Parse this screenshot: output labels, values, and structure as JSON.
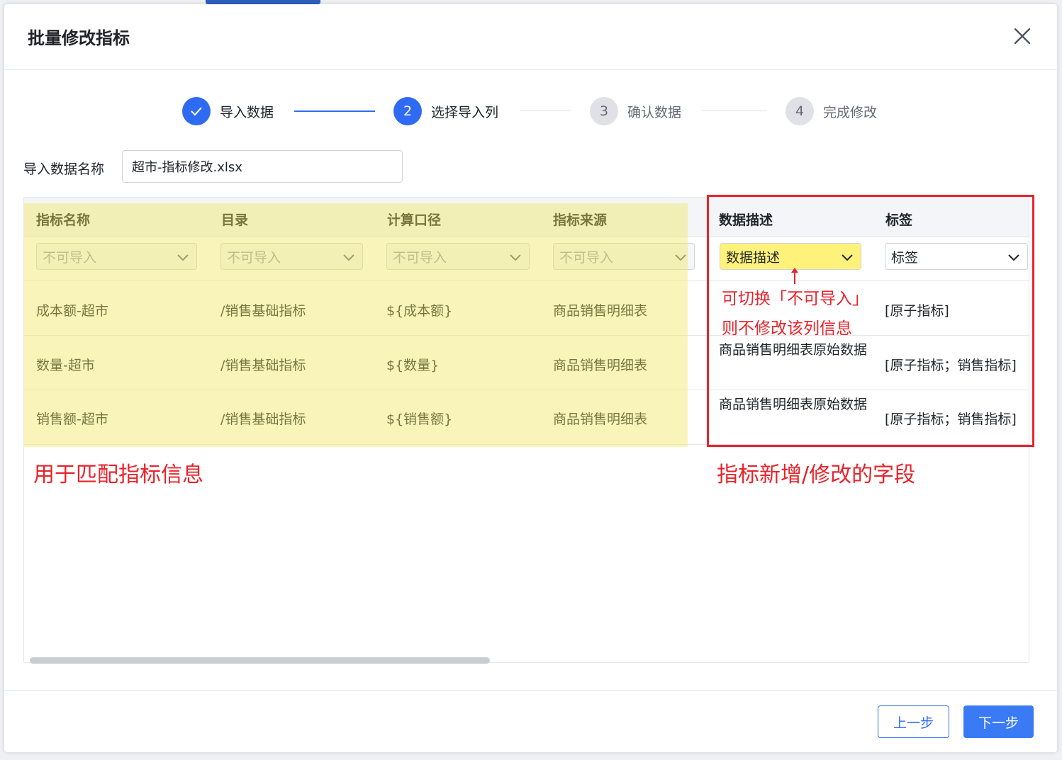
{
  "dialog": {
    "title": "批量修改指标"
  },
  "steps": [
    {
      "index": "✓",
      "label": "导入数据",
      "state": "done"
    },
    {
      "index": "2",
      "label": "选择导入列",
      "state": "active"
    },
    {
      "index": "3",
      "label": "确认数据",
      "state": "todo"
    },
    {
      "index": "4",
      "label": "完成修改",
      "state": "todo"
    }
  ],
  "import_name": {
    "label": "导入数据名称",
    "value": "超市-指标修改.xlsx"
  },
  "table": {
    "columns": [
      "指标名称",
      "目录",
      "计算口径",
      "指标来源",
      "数据描述",
      "标签"
    ],
    "selects": [
      "不可导入",
      "不可导入",
      "不可导入",
      "不可导入",
      "数据描述",
      "标签"
    ],
    "rows": [
      [
        "成本额-超市",
        "/销售基础指标",
        "${成本额}",
        "商品销售明细表",
        "",
        "[原子指标]"
      ],
      [
        "数量-超市",
        "/销售基础指标",
        "${数量}",
        "商品销售明细表",
        "商品销售明细表原始数据",
        "[原子指标；销售指标]"
      ],
      [
        "销售额-超市",
        "/销售基础指标",
        "${销售额}",
        "商品销售明细表",
        "商品销售明细表原始数据",
        "[原子指标；销售指标]"
      ]
    ]
  },
  "annotations": {
    "left": "用于匹配指标信息",
    "right": "指标新增/修改的字段",
    "switch_line1": "可切换「不可导入」",
    "switch_line2": "则不修改该列信息"
  },
  "footer": {
    "prev": "上一步",
    "next": "下一步"
  },
  "colors": {
    "primary": "#2f6bf2",
    "annotation_red": "#e8232b",
    "highlight_yellow": "#f0e65a"
  }
}
